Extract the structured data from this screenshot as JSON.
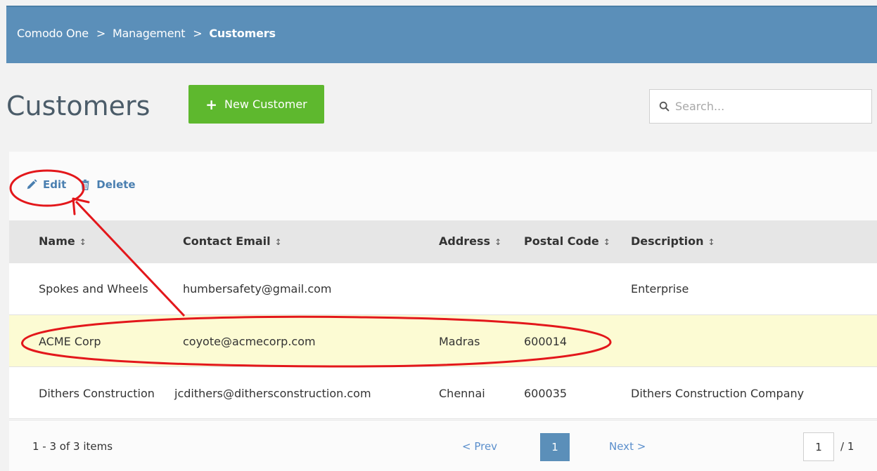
{
  "breadcrumb": {
    "items": [
      "Comodo One",
      "Management"
    ],
    "current": "Customers",
    "separator": ">"
  },
  "page": {
    "title": "Customers",
    "new_button_label": "New Customer",
    "search_placeholder": "Search..."
  },
  "toolbar": {
    "edit_label": "Edit",
    "delete_label": "Delete"
  },
  "table": {
    "columns": [
      "Name",
      "Contact Email",
      "Address",
      "Postal Code",
      "Description"
    ],
    "sort_icon": "↕",
    "rows": [
      {
        "name": "Spokes and Wheels",
        "email": "humbersafety@gmail.com",
        "address": "",
        "postal": "",
        "description": "Enterprise"
      },
      {
        "name": "ACME Corp",
        "email": "coyote@acmecorp.com",
        "address": "Madras",
        "postal": "600014",
        "description": ""
      },
      {
        "name": "Dithers Construction",
        "email": "jcdithers@dithersconstruction.com",
        "address": "Chennai",
        "postal": "600035",
        "description": "Dithers Construction Company"
      }
    ],
    "highlighted_row": 1
  },
  "pagination": {
    "info": "1 - 3 of 3 items",
    "prev_label": "< Prev",
    "current_page": "1",
    "next_label": "Next >",
    "page_input_value": "1",
    "total_label": "/ 1"
  },
  "colors": {
    "header_bar": "#5b8fb9",
    "primary_button": "#5eb82e",
    "link": "#4a7fb0",
    "highlight_row": "#fcfbd3",
    "annotation": "#e3171b"
  }
}
